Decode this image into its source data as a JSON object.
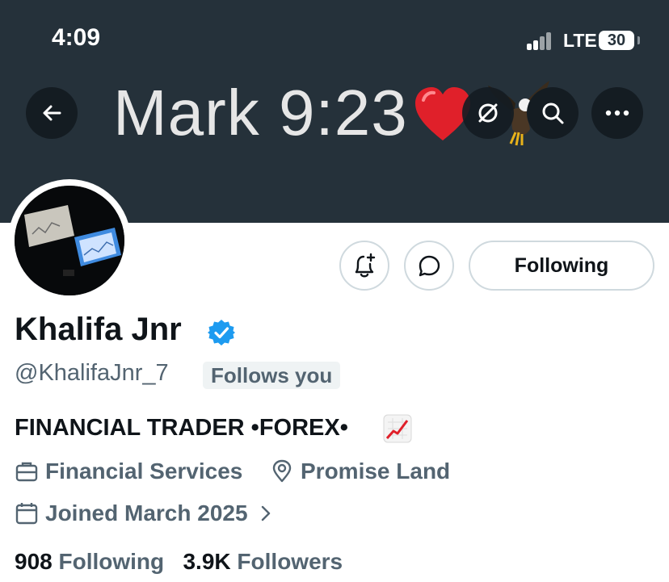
{
  "status_bar": {
    "time": "4:09",
    "network": "LTE",
    "battery": "30"
  },
  "banner": {
    "text": "Mark 9:23",
    "heart_icon": "red-heart-emoji",
    "eagle_icon": "eagle-emoji"
  },
  "nav": {
    "back_icon": "arrow-left-icon",
    "grok_icon": "slash-circle-icon",
    "search_icon": "search-icon",
    "more_icon": "more-horizontal-icon"
  },
  "actions": {
    "notify_icon": "bell-plus-icon",
    "message_icon": "chat-bubble-icon",
    "following_label": "Following"
  },
  "profile": {
    "name": "Khalifa Jnr",
    "handle": "@KhalifaJnr_7",
    "follows_you": "Follows you",
    "bio": "FINANCIAL TRADER •FOREX•",
    "category": "Financial Services",
    "location": "Promise Land",
    "joined": "Joined March 2025"
  },
  "stats": {
    "following_count": "908",
    "following_label": "Following",
    "followers_count": "3.9K",
    "followers_label": "Followers"
  },
  "colors": {
    "banner": "#25313a",
    "verified": "#1d9bf0",
    "muted": "#536471"
  }
}
